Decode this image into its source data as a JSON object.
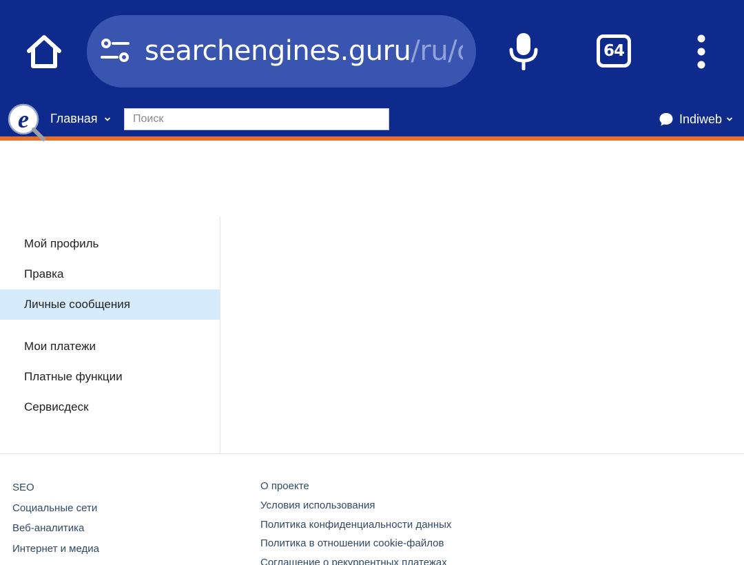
{
  "browser": {
    "url_host": "searchengines.guru",
    "url_path": "/ru/c",
    "tab_count": "64",
    "icons": [
      "home-icon",
      "site-settings-icon",
      "microphone-icon",
      "tabs-counter-icon",
      "overflow-menu-icon"
    ]
  },
  "header": {
    "home_label": "Главная",
    "search_placeholder": "Поиск",
    "username": "Indiweb"
  },
  "sidebar": {
    "items": [
      {
        "label": "Мой профиль",
        "active": false
      },
      {
        "label": "Правка",
        "active": false
      },
      {
        "label": "Личные сообщения",
        "active": true
      },
      {
        "label": "Мои платежи",
        "active": false
      },
      {
        "label": "Платные функции",
        "active": false
      },
      {
        "label": "Сервисдеск",
        "active": false
      }
    ]
  },
  "footer": {
    "col1": [
      "SEO",
      "Социальные сети",
      "Веб-аналитика",
      "Интернет и медиа"
    ],
    "col2": [
      "О проекте",
      "Условия использования",
      "Политика конфиденциальности данных",
      "Политика в отношении cookie-файлов",
      "Соглашение о рекуррентных платежах"
    ]
  },
  "colors": {
    "chrome_bg": "#0d2a8c",
    "urlbar_bg": "#3a55b0",
    "accent_orange": "#e8702a",
    "active_item_bg": "#d6ebfb",
    "footer_link": "#2f4a66"
  }
}
